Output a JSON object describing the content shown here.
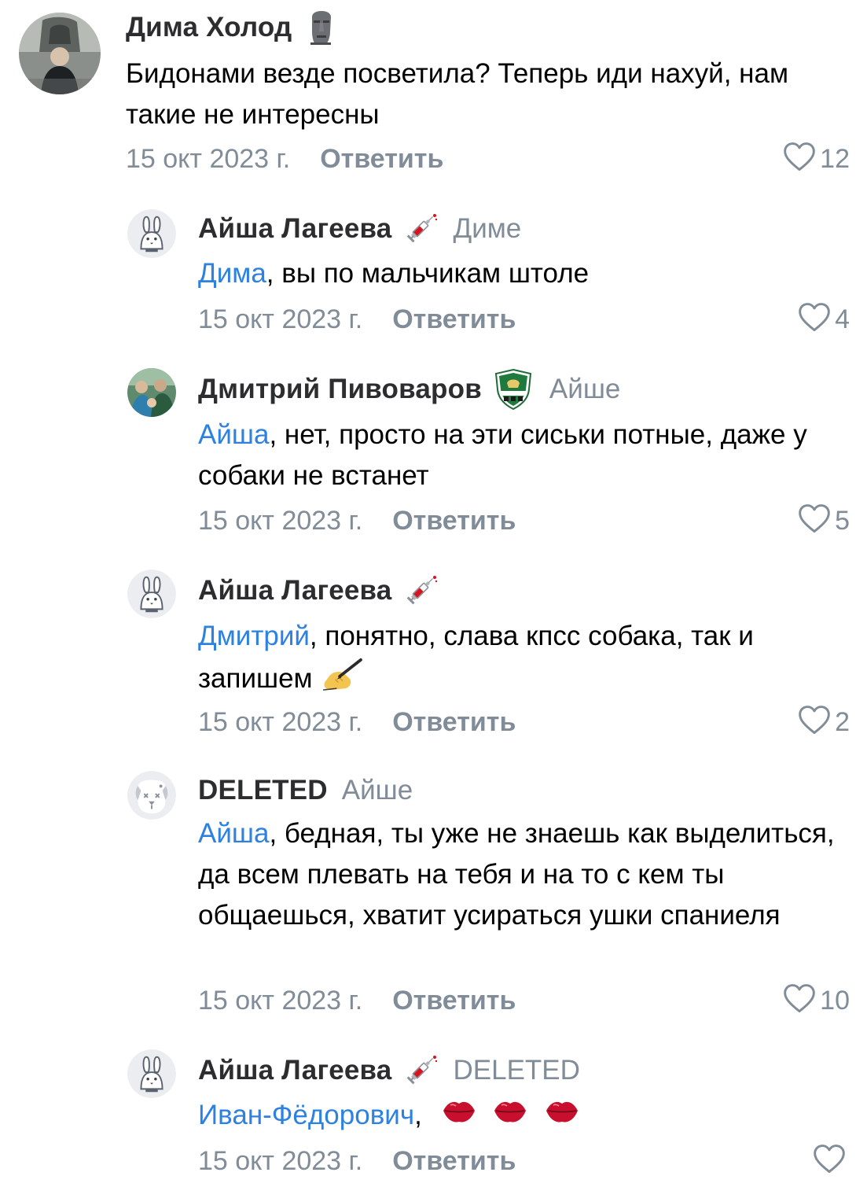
{
  "colors": {
    "author": "#2c2d2e",
    "secondary": "#818c99",
    "mention": "#2d81e0",
    "text": "#000000"
  },
  "comments": [
    {
      "author": "Дима Холод",
      "badge_icon": "moai-icon",
      "reply_to": "",
      "mention": "",
      "text": "Бидонами везде посветила? Теперь иди нахуй, нам такие не интересны",
      "date": "15 окт 2023 г.",
      "reply_label": "Ответить",
      "likes": "12"
    },
    {
      "author": "Айша Лагеева",
      "badge_icon": "syringe-icon",
      "reply_to": "Диме",
      "mention": "Дима",
      "text": ", вы по мальчикам штоле",
      "date": "15 окт 2023 г.",
      "reply_label": "Ответить",
      "likes": "4"
    },
    {
      "author": "Дмитрий Пивоваров",
      "badge_icon": "football-club-crest-icon",
      "reply_to": "Айше",
      "mention": "Айша",
      "text": ", нет, просто на эти сиськи потные, даже у собаки не встанет",
      "date": "15 окт 2023 г.",
      "reply_label": "Ответить",
      "likes": "5"
    },
    {
      "author": "Айша Лагеева",
      "badge_icon": "syringe-icon",
      "reply_to": "",
      "mention": "Дмитрий",
      "text": ", понятно, слава кпсс собака, так и запишем",
      "date": "15 окт 2023 г.",
      "reply_label": "Ответить",
      "likes": "2"
    },
    {
      "author": "DELETED",
      "badge_icon": "",
      "reply_to": "Айше",
      "mention": "Айша",
      "text": ", бедная, ты уже не знаешь как выделиться, да всем плевать на тебя и на то с кем ты общаешься, хватит усираться ушки спаниеля",
      "date": "15 окт 2023 г.",
      "reply_label": "Ответить",
      "likes": "10"
    },
    {
      "author": "Айша Лагеева",
      "badge_icon": "syringe-icon",
      "reply_to": "DELETED",
      "mention": "Иван-Фёдорович",
      "text": ",",
      "date": "15 окт 2023 г.",
      "reply_label": "Ответить",
      "likes": ""
    }
  ]
}
